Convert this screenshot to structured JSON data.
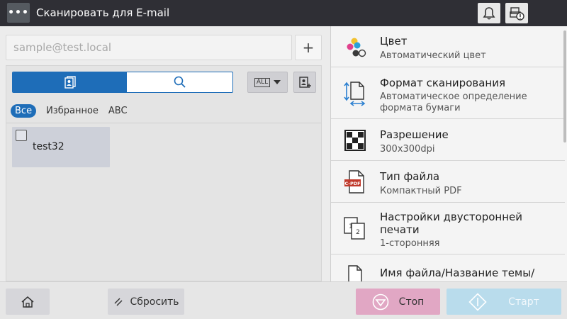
{
  "header": {
    "title": "Сканировать для E-mail",
    "menu_glyph": "•••",
    "icons": [
      "bell-icon",
      "job-status-icon"
    ]
  },
  "address": {
    "placeholder": "sample@test.local",
    "add_glyph": "+"
  },
  "addressbook": {
    "tabs": [
      "addressbook-icon",
      "search-icon"
    ],
    "index_label": "ALL",
    "filters": [
      "Все",
      "Избранное",
      "ABC"
    ],
    "entries": [
      {
        "label": "test32",
        "checked": false
      }
    ]
  },
  "settings": [
    {
      "title": "Цвет",
      "value": "Автоматический цвет",
      "icon": "color-icon"
    },
    {
      "title": "Формат сканирования",
      "value": "Автоматическое определение формата бумаги",
      "icon": "scan-size-icon"
    },
    {
      "title": "Разрешение",
      "value": "300x300dpi",
      "icon": "resolution-icon"
    },
    {
      "title": "Тип файла",
      "value": "Компактный PDF",
      "icon": "file-type-icon",
      "badge": "C-PDF"
    },
    {
      "title": "Настройки двусторонней печати",
      "value": "1-сторонняя",
      "icon": "duplex-icon"
    },
    {
      "title": "Имя файла/Название темы/Другое",
      "value": "",
      "icon": "filename-icon"
    }
  ],
  "footer": {
    "reset_label": "Сбросить",
    "stop_label": "Стоп",
    "start_label": "Старт"
  },
  "colors": {
    "accent": "#1e6db8",
    "stop": "#e1a7c4",
    "start": "#b9dcec"
  }
}
